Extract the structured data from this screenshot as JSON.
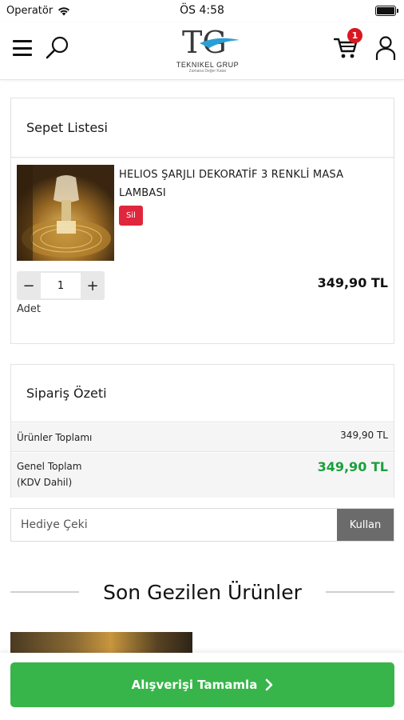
{
  "status_bar": {
    "carrier": "Operatör",
    "time": "ÖS 4:58"
  },
  "header": {
    "logo": {
      "brand": "TEKNIKEL GRUP",
      "slogan": "Zamana Değer Katar",
      "mark": "TG"
    },
    "cart_count": "1",
    "icons": [
      "menu-icon",
      "search-icon",
      "cart-icon",
      "user-icon"
    ]
  },
  "basket": {
    "title": "Sepet Listesi",
    "item": {
      "name": "HELIOS ŞARJLI DEKORATİF 3 RENKLİ MASA LAMBASI",
      "delete_label": "Sil",
      "quantity": "1",
      "quantity_label": "Adet",
      "decrement": "−",
      "increment": "+",
      "price": "349,90 TL"
    }
  },
  "summary": {
    "title": "Sipariş Özeti",
    "products_total_label": "Ürünler Toplamı",
    "products_total": "349,90 TL",
    "grand_total_label_1": "Genel Toplam",
    "grand_total_label_2": "(KDV Dahil)",
    "grand_total": "349,90 TL"
  },
  "gift": {
    "placeholder": "Hediye Çeki",
    "button": "Kullan"
  },
  "recent": {
    "title": "Son Gezilen Ürünler"
  },
  "checkout": {
    "label": "Alışverişi Tamamla",
    "arrow": "›"
  },
  "colors": {
    "accent_green": "#38b54a",
    "price_green": "#1aa03c",
    "delete_red": "#e0263d",
    "badge_red": "#d9171f",
    "gift_button": "#6b6b6b"
  }
}
